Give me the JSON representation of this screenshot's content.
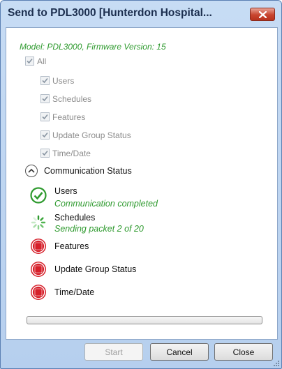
{
  "window": {
    "title": "Send to PDL3000 [Hunterdon Hospital...",
    "close_icon": "close-icon"
  },
  "model_info": "Model: PDL3000, Firmware Version: 15",
  "options": {
    "all": {
      "label": "All",
      "checked": true,
      "disabled": true
    },
    "items": [
      {
        "label": "Users",
        "checked": true,
        "disabled": true
      },
      {
        "label": "Schedules",
        "checked": true,
        "disabled": true
      },
      {
        "label": "Features",
        "checked": true,
        "disabled": true
      },
      {
        "label": "Update Group Status",
        "checked": true,
        "disabled": true
      },
      {
        "label": "Time/Date",
        "checked": true,
        "disabled": true
      }
    ]
  },
  "communication": {
    "section_label": "Communication Status",
    "toggle_icon": "chevron-up-icon",
    "items": [
      {
        "name": "Users",
        "detail": "Communication completed",
        "status": "completed",
        "icon": "check-circle-icon"
      },
      {
        "name": "Schedules",
        "detail": "Sending packet 2 of 20",
        "status": "in-progress",
        "icon": "spinner-icon"
      },
      {
        "name": "Features",
        "detail": "",
        "status": "pending",
        "icon": "stop-icon"
      },
      {
        "name": "Update Group Status",
        "detail": "",
        "status": "pending",
        "icon": "stop-icon"
      },
      {
        "name": "Time/Date",
        "detail": "",
        "status": "pending",
        "icon": "stop-icon"
      }
    ]
  },
  "progress": {
    "value": 0
  },
  "buttons": {
    "start": {
      "label": "Start",
      "disabled": true
    },
    "cancel": {
      "label": "Cancel"
    },
    "close": {
      "label": "Close"
    }
  },
  "colors": {
    "success_green": "#2e9a2e",
    "stop_red": "#d6202a",
    "title_bar": "#c7dcf4",
    "close_button": "#c8452f"
  }
}
